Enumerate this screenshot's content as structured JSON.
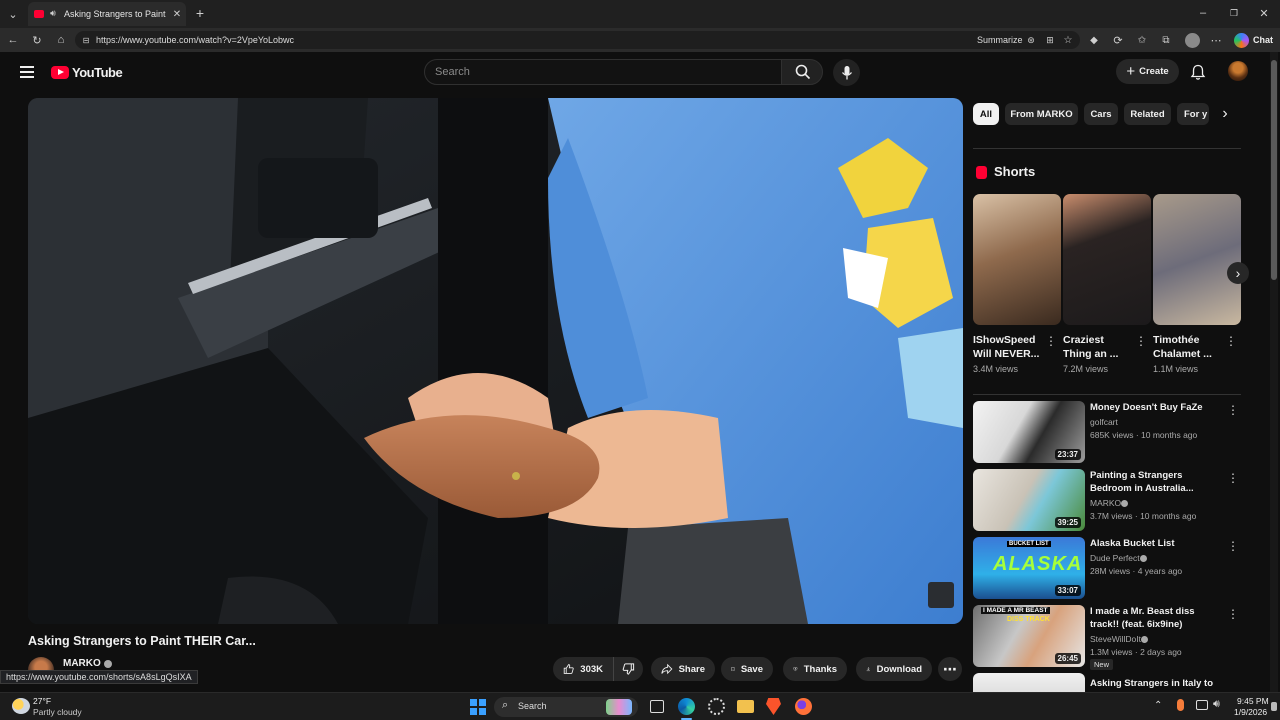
{
  "browser": {
    "tab_title": "Asking Strangers to Paint THEIR",
    "url": "https://www.youtube.com/watch?v=2VpeYoLobwc",
    "summarize_label": "Summarize",
    "chat_label": "Chat"
  },
  "youtube": {
    "logo_text": "YouTube",
    "search_placeholder": "Search",
    "create_label": "Create",
    "video_title": "Asking Strangers to Paint THEIR Car...",
    "channel_name": "MARKO",
    "like_count": "303K",
    "actions": {
      "share": "Share",
      "save": "Save",
      "thanks": "Thanks",
      "download": "Download"
    },
    "chips": [
      "All",
      "From MARKO",
      "Cars",
      "Related",
      "For y"
    ],
    "shorts_header": "Shorts",
    "shorts": [
      {
        "title": "IShowSpeed Will NEVER...",
        "views": "3.4M views"
      },
      {
        "title": "Craziest Thing an ...",
        "views": "7.2M views"
      },
      {
        "title": "Timothée Chalamet ...",
        "views": "1.1M views"
      }
    ],
    "recommendations": [
      {
        "title": "Money Doesn't Buy FaZe",
        "channel": "golfcart",
        "meta": "685K views · 10 months ago",
        "duration": "23:37",
        "verified": false,
        "badge": ""
      },
      {
        "title": "Painting a Strangers Bedroom in Australia...",
        "channel": "MARKO",
        "meta": "3.7M views · 10 months ago",
        "duration": "39:25",
        "verified": true,
        "badge": ""
      },
      {
        "title": "Alaska Bucket List",
        "channel": "Dude Perfect",
        "meta": "28M views · 4 years ago",
        "duration": "33:07",
        "verified": true,
        "badge": ""
      },
      {
        "title": "I made a Mr. Beast diss track!! (feat. 6ix9ine)",
        "channel": "SteveWillDoIt",
        "meta": "1.3M views · 2 days ago",
        "duration": "26:45",
        "verified": true,
        "badge": "New"
      },
      {
        "title": "Asking Strangers in Italy to",
        "channel": "",
        "meta": "",
        "duration": "",
        "verified": false,
        "badge": ""
      }
    ],
    "thumb_texts": {
      "bucket_list": "BUCKET LIST",
      "alaska": "ALASKA",
      "beast": "I MADE A MR BEAST",
      "diss": "DISS TRACK"
    }
  },
  "status_url": "https://www.youtube.com/shorts/sA8sLgQsIXA",
  "taskbar": {
    "weather_temp": "27°F",
    "weather_desc": "Partly cloudy",
    "search_label": "Search",
    "time": "9:45 PM",
    "date": "1/9/2026"
  },
  "colors": {
    "accent_red": "#ff0033",
    "bg": "#0f0f0f",
    "chip": "#272727"
  }
}
